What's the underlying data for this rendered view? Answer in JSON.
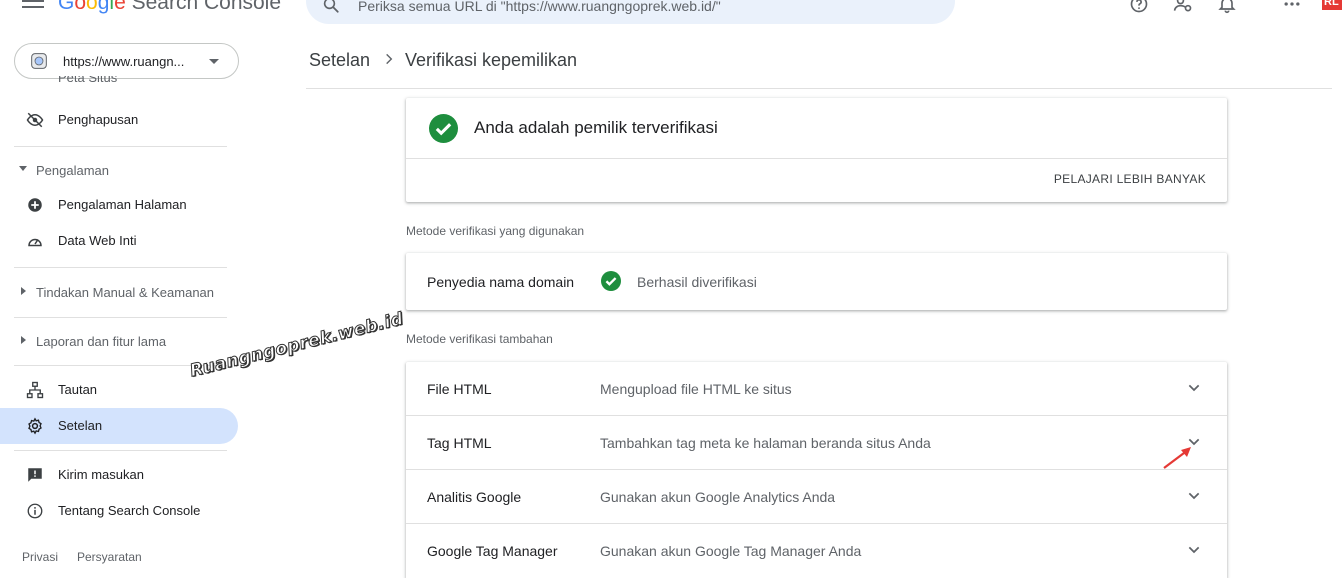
{
  "app": {
    "logo": {
      "G": "G",
      "o1": "o",
      "o2": "o",
      "g": "g",
      "l": "l",
      "e": "e",
      "rest": " Search Console"
    },
    "colors": {
      "accent_blue": "#1a73e8",
      "active_nav_bg": "#d3e3fd",
      "verified_green": "#1e8e3e",
      "arrow_red": "#e53935"
    }
  },
  "search": {
    "placeholder": "Periksa semua URL di \"https://www.ruangngoprek.web.id/\"",
    "icon": "search-icon"
  },
  "topbar_icons": [
    "help-icon",
    "manage-users-icon",
    "notifications-icon",
    "apps-grid-icon"
  ],
  "topbar_badge": "RL",
  "property": {
    "label": "https://www.ruangn..."
  },
  "sidebar": {
    "partial_item": "Peta Situs",
    "items_top": [
      {
        "label": "Penghapusan",
        "icon": "removal-eye-off-icon"
      }
    ],
    "section_experience": {
      "label": "Pengalaman"
    },
    "items_experience": [
      {
        "label": "Pengalaman Halaman",
        "icon": "plus-circle-icon"
      },
      {
        "label": "Data Web Inti",
        "icon": "speed-gauge-icon"
      }
    ],
    "section_security": {
      "label": "Tindakan Manual & Keamanan"
    },
    "section_legacy": {
      "label": "Laporan dan fitur lama"
    },
    "items_bottom": [
      {
        "label": "Tautan",
        "icon": "links-sitemap-icon"
      },
      {
        "label": "Setelan",
        "icon": "settings-gear-icon"
      }
    ],
    "items_feedback": [
      {
        "label": "Kirim masukan",
        "icon": "feedback-icon"
      },
      {
        "label": "Tentang Search Console",
        "icon": "info-icon"
      }
    ],
    "footer": {
      "privacy": "Privasi",
      "terms": "Persyaratan"
    }
  },
  "watermark": "Ruangngoprek.web.id",
  "breadcrumb": {
    "parent": "Setelan",
    "current": "Verifikasi kepemilikan"
  },
  "verified_card": {
    "title": "Anda adalah pemilik terverifikasi",
    "learn_more": "PELAJARI LEBIH BANYAK"
  },
  "used_methods": {
    "label": "Metode verifikasi yang digunakan",
    "items": [
      {
        "name": "Penyedia nama domain",
        "status": "Berhasil diverifikasi"
      }
    ]
  },
  "extra_methods": {
    "label": "Metode verifikasi tambahan",
    "items": [
      {
        "name": "File HTML",
        "desc": "Mengupload file HTML ke situs"
      },
      {
        "name": "Tag HTML",
        "desc": "Tambahkan tag meta ke halaman beranda situs Anda"
      },
      {
        "name": "Analitis Google",
        "desc": "Gunakan akun Google Analytics Anda"
      },
      {
        "name": "Google Tag Manager",
        "desc": "Gunakan akun Google Tag Manager Anda"
      }
    ]
  }
}
